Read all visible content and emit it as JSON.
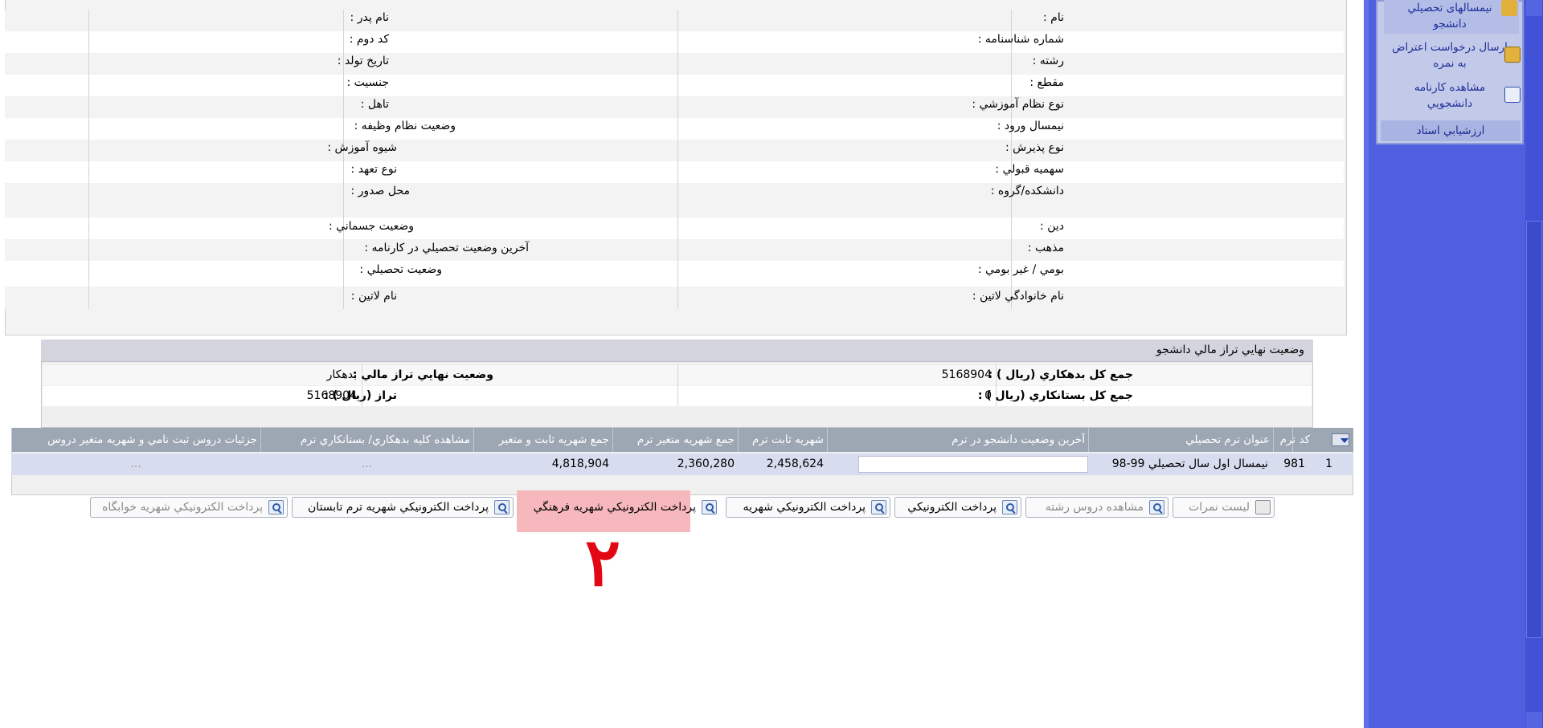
{
  "personal_info": {
    "rows": [
      {
        "right_label": "نام :",
        "left_label": "نام پدر :"
      },
      {
        "right_label": "شماره شناسنامه :",
        "left_label": "کد دوم :"
      },
      {
        "right_label": "رشته :",
        "left_label": "تاريخ تولد :"
      },
      {
        "right_label": "مقطع :",
        "left_label": "جنسيت :"
      },
      {
        "right_label": "نوع نظام آموزشي :",
        "left_label": "تاهل :"
      },
      {
        "right_label": "نيمسال ورود :",
        "left_label": "وضعيت نظام وظيفه :"
      },
      {
        "right_label": "نوع پذيرش :",
        "left_label": "شيوه آموزش :"
      },
      {
        "right_label": "سهميه قبولي :",
        "left_label": "نوع تعهد :"
      },
      {
        "right_label": "دانشکده/گروه :",
        "left_label": "محل صدور :"
      },
      {
        "right_label": "دين :",
        "left_label": "وضعيت جسماني :"
      },
      {
        "right_label": "مذهب :",
        "left_label": "آخرين وضعيت تحصيلي در کارنامه :"
      },
      {
        "right_label": "بومي / غير بومي :",
        "left_label": "وضعيت تحصيلي :"
      },
      {
        "right_label": "نام خانوادگي لاتين :",
        "left_label": "نام لاتين :"
      }
    ]
  },
  "financial": {
    "title": "وضعيت نهايي تراز مالي دانشجو",
    "rows": [
      {
        "right_label": "جمع کل بدهکاري (ريال ) :",
        "right_value": "5168904",
        "left_label": "وضعيت نهايي تراز مالي :",
        "left_value": "بدهکار"
      },
      {
        "right_label": "جمع کل بستانکاري (ريال ) :",
        "right_value": "0",
        "left_label": "تراز (ريال ) :",
        "left_value": "5168904"
      }
    ]
  },
  "terms_grid": {
    "columns": {
      "row_no": "",
      "term_code": "کد ترم",
      "term_title": "عنوان ترم تحصيلي",
      "last_status": "آخرين وضعيت دانشجو در ترم",
      "fixed_tuition": "شهريه ثابت ترم",
      "variable_tuition": "جمع شهريه متغير ترم",
      "total_tuition": "جمع شهريه ثابت و متغير",
      "debt_view": "مشاهده کليه بدهکاري/ بستانکاري ترم",
      "details": "جزئيات دروس ثبت نامي و شهريه متغير دروس"
    },
    "rows": [
      {
        "row_no": "1",
        "term_code": "981",
        "term_title": "نيمسال اول سال تحصيلي 99-98",
        "last_status": "",
        "fixed_tuition": "2,458,624",
        "variable_tuition": "2,360,280",
        "total_tuition": "4,818,904",
        "debt_view": "...",
        "details": "..."
      }
    ]
  },
  "buttons": {
    "grades_list": "ليست نمرات",
    "view_field_courses": "مشاهده دروس رشته",
    "e_payment": "پرداخت الکترونيکي",
    "e_payment_tuition": "پرداخت الکترونيکي شهريه",
    "e_payment_cultural": "پرداخت الکترونيکي شهريه فرهنگي",
    "e_payment_summer": "پرداخت الکترونيکي شهريه ترم تابستان",
    "e_payment_dorm": "پرداخت الکترونيکي شهريه خوابگاه"
  },
  "sidebar": {
    "items": [
      {
        "label_line1": "نيمسالهای تحصيلي",
        "label_line2": "دانشجو",
        "icon": "folder-lock-icon"
      },
      {
        "label_line1": "ارسال درخواست اعتراض",
        "label_line2": "به نمره",
        "icon": "lock-icon"
      },
      {
        "label_line1": "مشاهده کارنامه",
        "label_line2": "دانشجويي",
        "icon": "report-card-icon"
      },
      {
        "label_line1": "ارزشيابي استاد",
        "label_line2": "",
        "icon": ""
      }
    ]
  },
  "annotation": {
    "number": "۲"
  },
  "colors": {
    "sidebar_bg": "#4f5fe0",
    "grid_header": "#9da6b3",
    "highlight": "#f7b8bd",
    "annotation": "#e30613"
  }
}
